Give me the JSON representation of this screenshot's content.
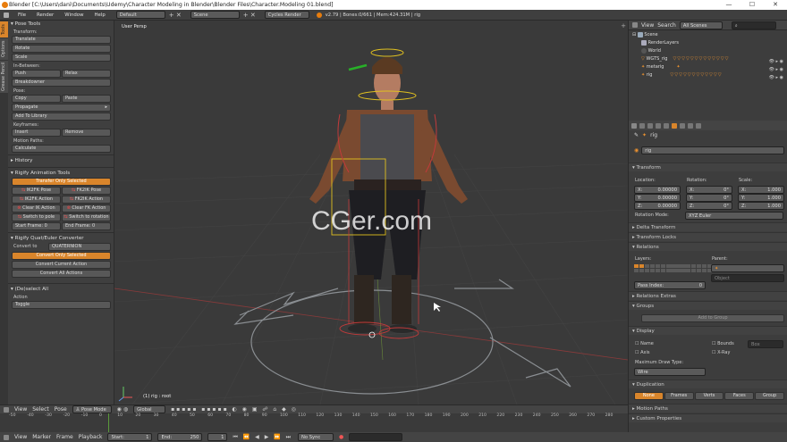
{
  "window": {
    "title": "Blender [C:\\Users\\dani\\Documents\\Udemy\\Character Modeling in Blender\\Blender Files\\Character.Modeling 01.blend]",
    "minimize": "—",
    "maximize": "☐",
    "close": "✕"
  },
  "menubar": {
    "items": [
      "File",
      "Render",
      "Window",
      "Help"
    ],
    "layout": "Default",
    "scene": "Scene",
    "engine": "Cycles Render",
    "stats": "v2.79 | Bones:0/661 | Mem:424.31M | rig"
  },
  "sidebar_tabs": [
    "Tools",
    "Options",
    "Grease Pencil"
  ],
  "tools": {
    "pose_tools": "Pose Tools",
    "transform_label": "Transform:",
    "translate": "Translate",
    "rotate": "Rotate",
    "scale": "Scale",
    "inbetween_label": "In-Between:",
    "push": "Push",
    "relax": "Relax",
    "breakdowner": "Breakdowner",
    "pose_label": "Pose:",
    "copy": "Copy",
    "paste": "Paste",
    "propagate": "Propagate",
    "add_library": "Add To Library",
    "keyframes_label": "Keyframes:",
    "insert": "Insert",
    "remove": "Remove",
    "motion_label": "Motion Paths:",
    "calculate": "Calculate",
    "history": "History",
    "rigify_tools": "Rigify Animation Tools",
    "transfer_only": "Transfer Only Selected",
    "ik2fk_pose": "IK2FK Pose",
    "fk2ik_pose": "FK2IK Pose",
    "ik2fk_action": "IK2FK Action",
    "fk2ik_action": "FK2IK Action",
    "clear_ik": "Clear IK Action",
    "clear_fk": "Clear FK Action",
    "switch_pole": "Switch to pole",
    "switch_rotation": "Switch to rotation",
    "start_frame": "Start Frame:",
    "start_frame_val": "0",
    "end_frame": "End Frame:",
    "end_frame_val": "0",
    "quat_euler": "Rigify Quat/Euler Converter",
    "convert_to": "Convert to",
    "convert_mode": "QUATERNION",
    "convert_only": "Convert Only Selected",
    "convert_current": "Convert Current Action",
    "convert_all": "Convert All Actions",
    "deselect_all": "(De)select All",
    "action_label": "Action",
    "action_val": "Toggle"
  },
  "viewport": {
    "view_label": "User Persp",
    "status": "(1) rig : root",
    "watermark": "CGer.com"
  },
  "viewport_header": {
    "items": [
      "View",
      "Select",
      "Pose"
    ],
    "mode": "Pose Mode",
    "orientation": "Global"
  },
  "outliner": {
    "view": "View",
    "search": "Search",
    "scenes": "All Scenes",
    "rows": [
      "Scene",
      "RenderLayers",
      "World",
      "WGTS_rig",
      "metarig",
      "rig"
    ]
  },
  "properties": {
    "object": "rig",
    "name": "rig",
    "transform": "Transform",
    "location": "Location:",
    "rotation": "Rotation:",
    "scale": "Scale:",
    "loc": [
      {
        "axis": "X:",
        "val": "0.00000"
      },
      {
        "axis": "Y:",
        "val": "0.00000"
      },
      {
        "axis": "Z:",
        "val": "0.00000"
      }
    ],
    "rot": [
      {
        "axis": "X:",
        "val": "0°"
      },
      {
        "axis": "Y:",
        "val": "0°"
      },
      {
        "axis": "Z:",
        "val": "0°"
      }
    ],
    "scl": [
      {
        "axis": "X:",
        "val": "1.000"
      },
      {
        "axis": "Y:",
        "val": "1.000"
      },
      {
        "axis": "Z:",
        "val": "1.000"
      }
    ],
    "rotation_mode_label": "Rotation Mode:",
    "rotation_mode": "XYZ Euler",
    "delta": "Delta Transform",
    "locks": "Transform Locks",
    "relations": "Relations",
    "layers": "Layers:",
    "parent": "Parent:",
    "object_field": "Object",
    "pass_index": "Pass Index:",
    "pass_index_val": "0",
    "relations_extras": "Relations Extras",
    "groups": "Groups",
    "add_to_group": "Add to Group",
    "display": "Display",
    "name_chk": "Name",
    "bounds_chk": "Bounds",
    "bounds_mode": "Box",
    "axis_chk": "Axis",
    "xray_chk": "X-Ray",
    "max_draw": "Maximum Draw Type:",
    "max_draw_val": "Wire",
    "duplication": "Duplication",
    "dup_none": "None",
    "dup_frames": "Frames",
    "dup_verts": "Verts",
    "dup_faces": "Faces",
    "dup_group": "Group",
    "motion_paths": "Motion Paths",
    "custom_props": "Custom Properties"
  },
  "timeline": {
    "ticks": [
      "-50",
      "-40",
      "-30",
      "-20",
      "-10",
      "0",
      "10",
      "20",
      "30",
      "40",
      "50",
      "60",
      "70",
      "80",
      "90",
      "100",
      "110",
      "120",
      "130",
      "140",
      "150",
      "160",
      "170",
      "180",
      "190",
      "200",
      "210",
      "220",
      "230",
      "240",
      "250",
      "260",
      "270",
      "280"
    ],
    "view": "View",
    "marker": "Marker",
    "frame": "Frame",
    "playback": "Playback",
    "start_label": "Start:",
    "start": "1",
    "end_label": "End:",
    "end": "250",
    "current": "1",
    "sync": "No Sync"
  },
  "colors": {
    "accent": "#d9852b",
    "bg": "#393939"
  }
}
